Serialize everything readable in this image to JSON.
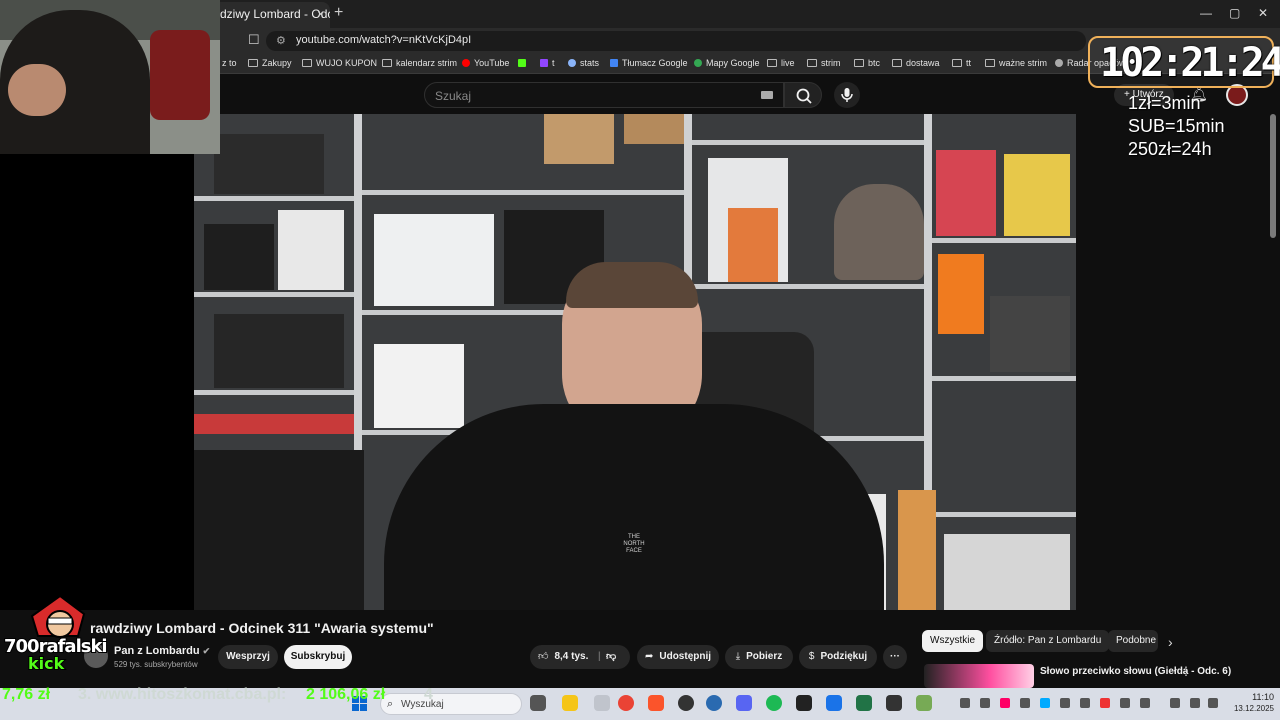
{
  "browser": {
    "tab_title": "dziwy Lombard - Odcine",
    "tab_close": "×",
    "new_tab": "+",
    "url": "youtube.com/watch?v=nKtVcKjD4pI",
    "window_controls": [
      "—",
      "▢",
      "✕"
    ],
    "bookmarks": [
      {
        "label": "z to",
        "icon": "folder-icon"
      },
      {
        "label": "Zakupy",
        "icon": "folder-icon"
      },
      {
        "label": "WUJO KUPON",
        "icon": "folder-icon"
      },
      {
        "label": "kalendarz strim",
        "icon": "folder-icon"
      },
      {
        "label": "YouTube",
        "icon": "youtube-icon"
      },
      {
        "label": "",
        "icon": "kick-icon"
      },
      {
        "label": "t",
        "icon": "twitch-icon"
      },
      {
        "label": "stats",
        "icon": "link-icon"
      },
      {
        "label": "Tłumacz Google",
        "icon": "translate-icon"
      },
      {
        "label": "Mapy Google",
        "icon": "maps-icon"
      },
      {
        "label": "live",
        "icon": "folder-icon"
      },
      {
        "label": "strim",
        "icon": "folder-icon"
      },
      {
        "label": "btc",
        "icon": "folder-icon"
      },
      {
        "label": "dostawa",
        "icon": "folder-icon"
      },
      {
        "label": "tt",
        "icon": "folder-icon"
      },
      {
        "label": "ważne strim",
        "icon": "folder-icon"
      },
      {
        "label": "Radar opadów",
        "icon": "radar-icon"
      }
    ]
  },
  "youtube": {
    "search_placeholder": "Szukaj",
    "create_label": "Utwórz",
    "video_title": "rawdziwy Lombard - Odcinek 311 \"Awaria systemu\"",
    "channel_name": "Pan z Lombardu",
    "channel_subs": "529 tys. subskrybentów",
    "support_label": "Wesprzyj",
    "subscribe_label": "Subskrybuj",
    "likes": "8,4 tys.",
    "share_label": "Udostępnij",
    "download_label": "Pobierz",
    "thanks_label": "Podziękuj",
    "more_label": "···",
    "chips": [
      "Wszystkie",
      "Źródło: Pan z Lombardu",
      "Podobne"
    ],
    "rec_title": "Słowo przeciwko słowu (Giełda - Odc. 6)"
  },
  "overlay": {
    "timer": "102:21:24",
    "rates": [
      "1zł=3min",
      "SUB=15min",
      "250zł=24h"
    ],
    "kick_name": "700rafalski",
    "kick_word": "kick",
    "ticker_amount": "7,76 zł",
    "ticker_text": "3. www.hitoszkomat.cba.pl:",
    "ticker_amount2": "2 106,06 zł",
    "ticker_extra": "4"
  },
  "taskbar": {
    "search_placeholder": "Wyszukaj",
    "time": "11:10",
    "date": "13.12.2025"
  },
  "colors": {
    "accent_green": "#53fc18",
    "timer_border": "#f0b15a",
    "taskbar_bg": "#d9dde6"
  }
}
